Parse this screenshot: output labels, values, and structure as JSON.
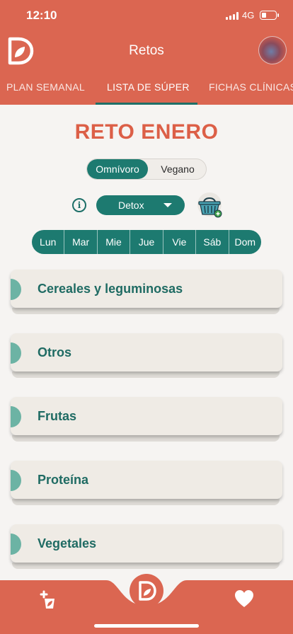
{
  "status_bar": {
    "time": "12:10",
    "network": "4G"
  },
  "header": {
    "title": "Retos",
    "tabs": [
      {
        "label": "PLAN SEMANAL",
        "active": false
      },
      {
        "label": "LISTA DE SÚPER",
        "active": true
      },
      {
        "label": "FICHAS CLÍNICAS",
        "active": false
      }
    ],
    "logo_icon": "leaf-d-logo-icon",
    "avatar_icon": "user-avatar"
  },
  "main": {
    "title": "RETO ENERO",
    "diet_options": [
      {
        "label": "Omnívoro",
        "selected": true
      },
      {
        "label": "Vegano",
        "selected": false
      }
    ],
    "plan_select": {
      "value": "Detox"
    },
    "days": [
      "Lun",
      "Mar",
      "Mie",
      "Jue",
      "Vie",
      "Sáb",
      "Dom"
    ],
    "categories": [
      "Cereales y leguminosas",
      "Otros",
      "Frutas",
      "Proteína",
      "Vegetales"
    ]
  },
  "bottom_nav": {
    "icons": [
      "add-leaf-icon",
      "leaf-d-logo-icon",
      "heart-icon"
    ]
  },
  "colors": {
    "brand": "#db6651",
    "title": "#dc5f47",
    "accent": "#1d7a70",
    "category_text": "#1f6b63",
    "category_marker": "#6cb3a4",
    "card_bg": "#efebe5"
  }
}
